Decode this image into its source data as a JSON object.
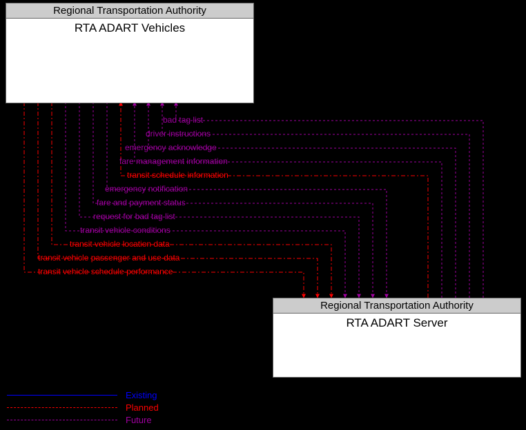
{
  "entities": {
    "top": {
      "header": "Regional Transportation Authority",
      "title": "RTA ADART Vehicles"
    },
    "bottom": {
      "header": "Regional Transportation Authority",
      "title": "RTA ADART Server"
    }
  },
  "flows": [
    {
      "label": "bad tag list",
      "status": "future"
    },
    {
      "label": "driver instructions",
      "status": "future"
    },
    {
      "label": "emergency acknowledge",
      "status": "future"
    },
    {
      "label": "fare management information",
      "status": "future"
    },
    {
      "label": "transit schedule information",
      "status": "planned"
    },
    {
      "label": "emergency notification",
      "status": "future"
    },
    {
      "label": "fare and payment status",
      "status": "future"
    },
    {
      "label": "request for bad tag list",
      "status": "future"
    },
    {
      "label": "transit vehicle conditions",
      "status": "future"
    },
    {
      "label": "transit vehicle location data",
      "status": "planned"
    },
    {
      "label": "transit vehicle passenger and use data",
      "status": "planned"
    },
    {
      "label": "transit vehicle schedule performance",
      "status": "planned"
    }
  ],
  "legend": {
    "existing": "Existing",
    "planned": "Planned",
    "future": "Future"
  }
}
